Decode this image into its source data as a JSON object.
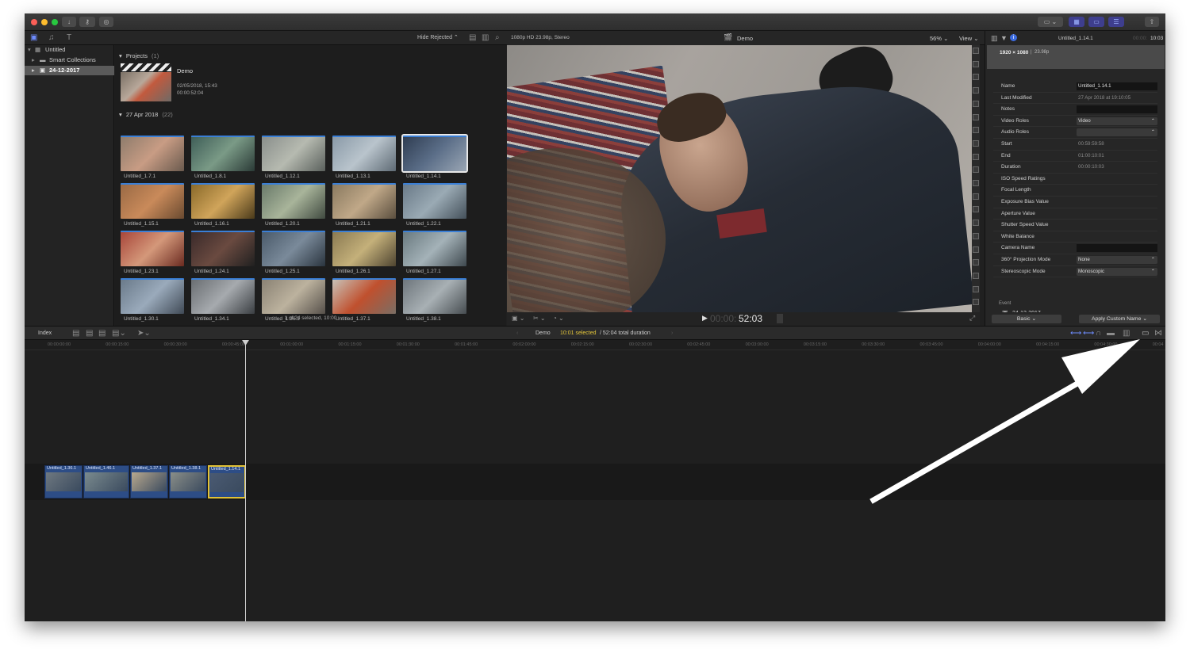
{
  "browser": {
    "filter_label": "Hide Rejected",
    "projects_header": "Projects",
    "projects_count": "(1)",
    "project": {
      "name": "Demo",
      "date": "02/05/2018, 15:43",
      "duration": "00:00:52:04"
    },
    "event_header": "27 Apr 2018",
    "event_count": "(22)",
    "clips": [
      "Untitled_1.7.1",
      "Untitled_1.8.1",
      "Untitled_1.12.1",
      "Untitled_1.13.1",
      "Untitled_1.14.1",
      "Untitled_1.15.1",
      "Untitled_1.16.1",
      "Untitled_1.20.1",
      "Untitled_1.21.1",
      "Untitled_1.22.1",
      "Untitled_1.23.1",
      "Untitled_1.24.1",
      "Untitled_1.25.1",
      "Untitled_1.26.1",
      "Untitled_1.27.1",
      "Untitled_1.30.1",
      "Untitled_1.34.1",
      "Untitled_1.36.1",
      "Untitled_1.37.1",
      "Untitled_1.38.1"
    ],
    "selected_clip_index": 4,
    "status": "1 of 24 selected, 10:00"
  },
  "libraries": {
    "items": [
      {
        "label": "Untitled",
        "icon": "library-icon"
      },
      {
        "label": "Smart Collections",
        "icon": "folder-icon"
      },
      {
        "label": "24-12-2017",
        "icon": "event-icon"
      }
    ]
  },
  "viewer": {
    "format": "1080p HD 23.98p, Stereo",
    "title": "Demo",
    "zoom": "56%",
    "view_label": "View",
    "timecode_dim": "00:00:",
    "timecode": "52:03"
  },
  "inspector": {
    "clip_title": "Untitled_1.14.1",
    "duration_dim": "00:00:",
    "duration": "10:03",
    "resolution": "1920 × 1080",
    "frame_rate": "23.98p",
    "rows": [
      {
        "label": "Name",
        "value": "Untitled_1.14.1",
        "style": "box"
      },
      {
        "label": "Last Modified",
        "value": "27 Apr 2018 at 19:10:05",
        "style": "plain"
      },
      {
        "label": "Notes",
        "value": "",
        "style": "box"
      },
      {
        "label": "Video Roles",
        "value": "Video",
        "style": "pop"
      },
      {
        "label": "Audio Roles",
        "value": "",
        "style": "pop"
      },
      {
        "label": "Start",
        "value": "00:59:59:58",
        "style": "plain"
      },
      {
        "label": "End",
        "value": "01:00:10:01",
        "style": "plain"
      },
      {
        "label": "Duration",
        "value": "00:00:10:03",
        "style": "plain"
      },
      {
        "label": "ISO Speed Ratings",
        "value": "",
        "style": "plain"
      },
      {
        "label": "Focal Length",
        "value": "",
        "style": "plain"
      },
      {
        "label": "Exposure Bias Value",
        "value": "",
        "style": "plain"
      },
      {
        "label": "Aperture Value",
        "value": "",
        "style": "plain"
      },
      {
        "label": "Shutter Speed Value",
        "value": "",
        "style": "plain"
      },
      {
        "label": "White Balance",
        "value": "",
        "style": "plain"
      },
      {
        "label": "Camera Name",
        "value": "",
        "style": "box"
      },
      {
        "label": "360° Projection Mode",
        "value": "None",
        "style": "pop"
      },
      {
        "label": "Stereoscopic Mode",
        "value": "Monoscopic",
        "style": "pop"
      }
    ],
    "event_label": "Event",
    "event_value": "24-12-2017",
    "metadata_view": "Basic",
    "apply_button": "Apply Custom Name"
  },
  "timeline": {
    "index_label": "Index",
    "project_name": "Demo",
    "selected_text": "10:01 selected",
    "total_text": "/ 52:04 total duration",
    "ruler": [
      "00:00:00:00",
      "00:00:15:00",
      "00:00:30:00",
      "00:00:45:00",
      "00:01:00:00",
      "00:01:15:00",
      "00:01:30:00",
      "00:01:45:00",
      "00:02:00:00",
      "00:02:15:00",
      "00:02:30:00",
      "00:02:45:00",
      "00:03:00:00",
      "00:03:15:00",
      "00:03:30:00",
      "00:03:45:00",
      "00:04:00:00",
      "00:04:15:00",
      "00:04:30:00",
      "00:04"
    ],
    "clips": [
      {
        "name": "Untitled_1.36.1",
        "selected": false
      },
      {
        "name": "Untitled_1.46.1",
        "selected": false
      },
      {
        "name": "Untitled_1.37.1",
        "selected": false
      },
      {
        "name": "Untitled_1.38.1",
        "selected": false
      },
      {
        "name": "Untitled_1.14.1",
        "selected": true
      }
    ]
  },
  "colors": {
    "accent": "#3a7fd6",
    "selection_yellow": "#e2c236",
    "selected_text_yellow": "#e3c53a",
    "annotation_arrow": "#ffffff"
  }
}
